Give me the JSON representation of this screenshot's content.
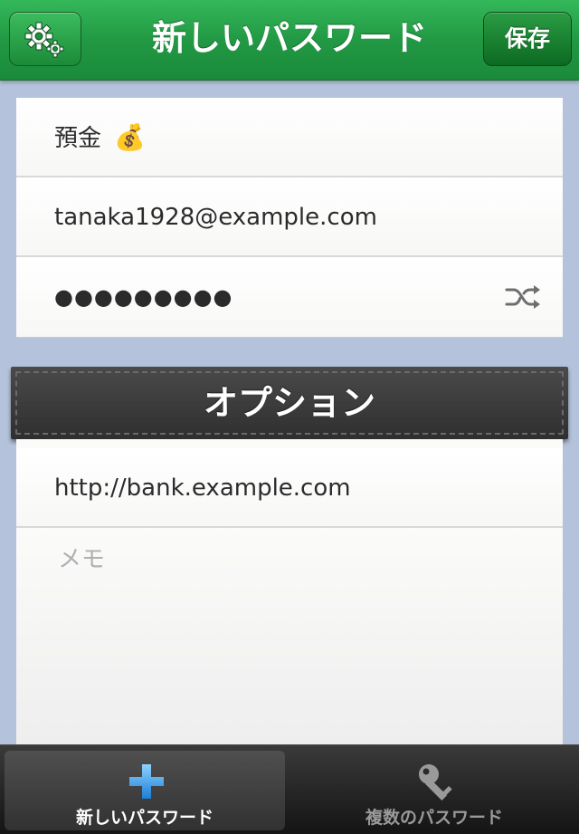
{
  "navbar": {
    "title": "新しいパスワード",
    "save_label": "保存",
    "settings_icon": "gears-icon"
  },
  "entry": {
    "title": "預金",
    "title_emoji": "💰",
    "username": "tanaka1928@example.com",
    "password_masked": "●●●●●●●●●",
    "shuffle_icon": "shuffle-icon"
  },
  "options": {
    "header": "オプション",
    "url": "http://bank.example.com",
    "memo_placeholder": "メモ"
  },
  "tabbar": {
    "tabs": [
      {
        "label": "新しいパスワード",
        "icon": "plus-icon",
        "active": true
      },
      {
        "label": "複数のパスワード",
        "icon": "key-icon",
        "active": false
      }
    ]
  },
  "colors": {
    "navbar_green": "#229944",
    "background": "#b4c2db",
    "tab_active_text": "#ffffff",
    "tab_inactive_text": "#9a9a9a"
  }
}
